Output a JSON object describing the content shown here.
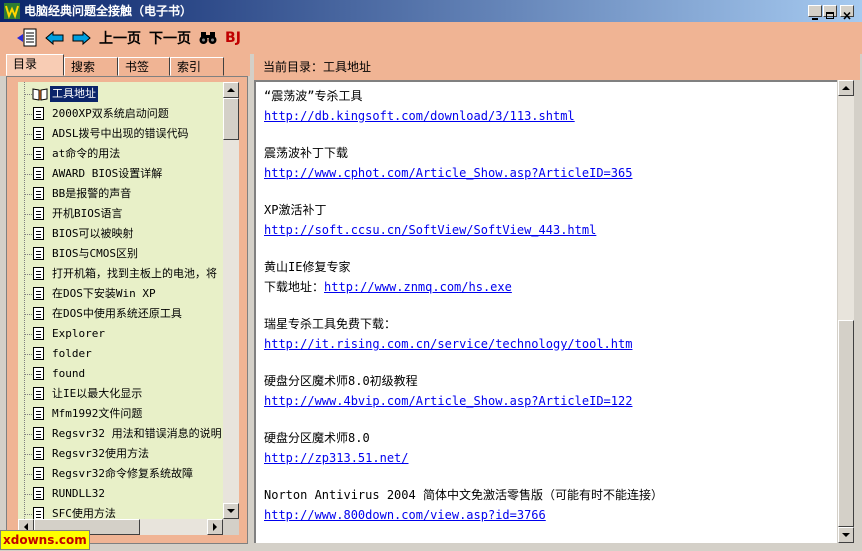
{
  "window": {
    "title": "电脑经典问题全接触（电子书）"
  },
  "toolbar": {
    "prev_label": "上一页",
    "next_label": "下一页",
    "bj_label": "BJ"
  },
  "tabs": [
    {
      "label": "目录",
      "active": true
    },
    {
      "label": "搜索"
    },
    {
      "label": "书签"
    },
    {
      "label": "索引"
    }
  ],
  "tree": {
    "items": [
      "工具地址",
      "2000XP双系统启动问题",
      "ADSL拨号中出现的错误代码",
      "at命令的用法",
      "AWARD BIOS设置详解",
      "BB是报警的声音",
      "开机BIOS语言",
      "BIOS可以被映射",
      "BIOS与CMOS区别",
      "打开机箱，找到主板上的电池，将",
      "在DOS下安装Win XP",
      "在DOS中使用系统还原工具",
      "Explorer",
      "folder",
      "found",
      "让IE以最大化显示",
      "Mfm1992文件问题",
      "Regsvr32 用法和错误消息的说明",
      "Regsvr32使用方法",
      "Regsvr32命令修复系统故障",
      "RUNDLL32",
      "SFC使用方法"
    ]
  },
  "content": {
    "current_dir": "当前目录：工具地址",
    "entries": [
      {
        "title": "“震荡波”专杀工具",
        "url": "http://db.kingsoft.com/download/3/113.shtml"
      },
      {
        "title": "震荡波补丁下载",
        "url": "http://www.cphot.com/Article_Show.asp?ArticleID=365"
      },
      {
        "title": "XP激活补丁",
        "url": "http://soft.ccsu.cn/SoftView/SoftView_443.html"
      },
      {
        "title": "黄山IE修复专家",
        "prefix": "下载地址：",
        "url": "http://www.znmq.com/hs.exe"
      },
      {
        "title": "瑞星专杀工具免费下载：",
        "url": "http://it.rising.com.cn/service/technology/tool.htm"
      },
      {
        "title": "硬盘分区魔术师8.0初级教程",
        "url": "http://www.4bvip.com/Article_Show.asp?ArticleID=122"
      },
      {
        "title": "硬盘分区魔术师8.0",
        "url": "http://zp313.51.net/"
      },
      {
        "title": "Norton Antivirus 2004 简体中文免激活零售版（可能有时不能连接）",
        "url": "http://www.800down.com/view.asp?id=3766"
      }
    ]
  },
  "watermark": "xdowns.com"
}
